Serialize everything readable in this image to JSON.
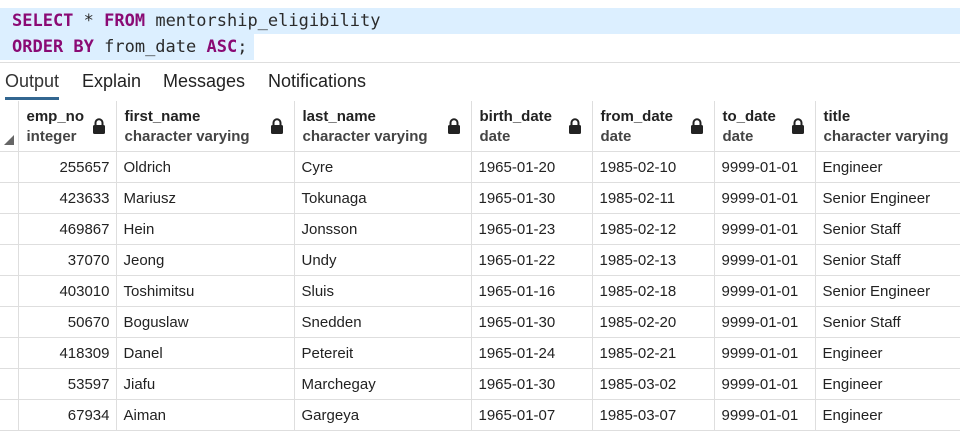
{
  "editor": {
    "line1": {
      "kw1": "SELECT",
      "star": " * ",
      "kw2": "FROM",
      "rest": " mentorship_eligibility"
    },
    "line2": {
      "kw1": "ORDER BY",
      "mid": " from_date ",
      "kw2": "ASC",
      "end": ";"
    }
  },
  "tabs": [
    {
      "label": "Output"
    },
    {
      "label": "Explain"
    },
    {
      "label": "Messages"
    },
    {
      "label": "Notifications"
    }
  ],
  "columns": [
    {
      "name": "emp_no",
      "type": "integer"
    },
    {
      "name": "first_name",
      "type": "character varying"
    },
    {
      "name": "last_name",
      "type": "character varying"
    },
    {
      "name": "birth_date",
      "type": "date"
    },
    {
      "name": "from_date",
      "type": "date"
    },
    {
      "name": "to_date",
      "type": "date"
    },
    {
      "name": "title",
      "type": "character varying"
    }
  ],
  "rows": [
    [
      "255657",
      "Oldrich",
      "Cyre",
      "1965-01-20",
      "1985-02-10",
      "9999-01-01",
      "Engineer"
    ],
    [
      "423633",
      "Mariusz",
      "Tokunaga",
      "1965-01-30",
      "1985-02-11",
      "9999-01-01",
      "Senior Engineer"
    ],
    [
      "469867",
      "Hein",
      "Jonsson",
      "1965-01-23",
      "1985-02-12",
      "9999-01-01",
      "Senior Staff"
    ],
    [
      "37070",
      "Jeong",
      "Undy",
      "1965-01-22",
      "1985-02-13",
      "9999-01-01",
      "Senior Staff"
    ],
    [
      "403010",
      "Toshimitsu",
      "Sluis",
      "1965-01-16",
      "1985-02-18",
      "9999-01-01",
      "Senior Engineer"
    ],
    [
      "50670",
      "Boguslaw",
      "Snedden",
      "1965-01-30",
      "1985-02-20",
      "9999-01-01",
      "Senior Staff"
    ],
    [
      "418309",
      "Danel",
      "Petereit",
      "1965-01-24",
      "1985-02-21",
      "9999-01-01",
      "Engineer"
    ],
    [
      "53597",
      "Jiafu",
      "Marchegay",
      "1965-01-30",
      "1985-03-02",
      "9999-01-01",
      "Engineer"
    ],
    [
      "67934",
      "Aiman",
      "Gargeya",
      "1965-01-07",
      "1985-03-07",
      "9999-01-01",
      "Engineer"
    ]
  ]
}
